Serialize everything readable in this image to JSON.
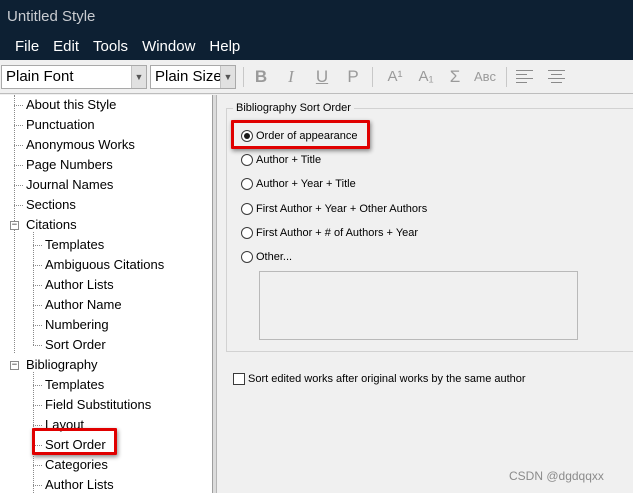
{
  "window": {
    "title": "Untitled Style"
  },
  "menu": [
    "File",
    "Edit",
    "Tools",
    "Window",
    "Help"
  ],
  "toolbar": {
    "font_combo": "Plain Font",
    "size_combo": "Plain Size",
    "format_buttons": [
      {
        "icon": "bold-icon",
        "glyph": "B"
      },
      {
        "icon": "italic-icon",
        "glyph": "I"
      },
      {
        "icon": "underline-icon",
        "glyph": "U"
      },
      {
        "icon": "plain-icon",
        "glyph": "P"
      }
    ],
    "script_buttons": [
      {
        "icon": "superscript-icon",
        "glyph": "A¹"
      },
      {
        "icon": "subscript-icon",
        "glyph": "A₁"
      },
      {
        "icon": "sigma-icon",
        "glyph": "Σ"
      },
      {
        "icon": "small-caps-icon",
        "glyph": "Aʙᴄ"
      }
    ],
    "align_buttons": [
      {
        "icon": "align-left-icon"
      },
      {
        "icon": "align-center-icon"
      }
    ]
  },
  "tree": {
    "items": [
      {
        "label": "About this Style",
        "level": 0
      },
      {
        "label": "Punctuation",
        "level": 0
      },
      {
        "label": "Anonymous Works",
        "level": 0
      },
      {
        "label": "Page Numbers",
        "level": 0
      },
      {
        "label": "Journal Names",
        "level": 0
      },
      {
        "label": "Sections",
        "level": 0
      },
      {
        "label": "Citations",
        "level": 0,
        "expanded": true
      },
      {
        "label": "Templates",
        "level": 1
      },
      {
        "label": "Ambiguous Citations",
        "level": 1
      },
      {
        "label": "Author Lists",
        "level": 1
      },
      {
        "label": "Author Name",
        "level": 1
      },
      {
        "label": "Numbering",
        "level": 1
      },
      {
        "label": "Sort Order",
        "level": 1
      },
      {
        "label": "Bibliography",
        "level": 0,
        "expanded": true
      },
      {
        "label": "Templates",
        "level": 1
      },
      {
        "label": "Field Substitutions",
        "level": 1
      },
      {
        "label": "Layout",
        "level": 1
      },
      {
        "label": "Sort Order",
        "level": 1,
        "selected": true
      },
      {
        "label": "Categories",
        "level": 1
      },
      {
        "label": "Author Lists",
        "level": 1
      }
    ]
  },
  "sort_panel": {
    "group_title": "Bibliography Sort Order",
    "options": [
      {
        "label": "Order of appearance",
        "checked": true
      },
      {
        "label": "Author + Title",
        "checked": false
      },
      {
        "label": "Author + Year + Title",
        "checked": false
      },
      {
        "label": "First Author + Year + Other Authors",
        "checked": false
      },
      {
        "label": "First Author + # of Authors + Year",
        "checked": false
      },
      {
        "label": "Other...",
        "checked": false
      }
    ],
    "other_value": "",
    "checkbox_label": "Sort edited works after original works by the same author",
    "checkbox_checked": false
  },
  "colors": {
    "titlebar": "#0d2033",
    "highlight": "#e00000"
  },
  "watermark": "CSDN @dgdqqxx"
}
